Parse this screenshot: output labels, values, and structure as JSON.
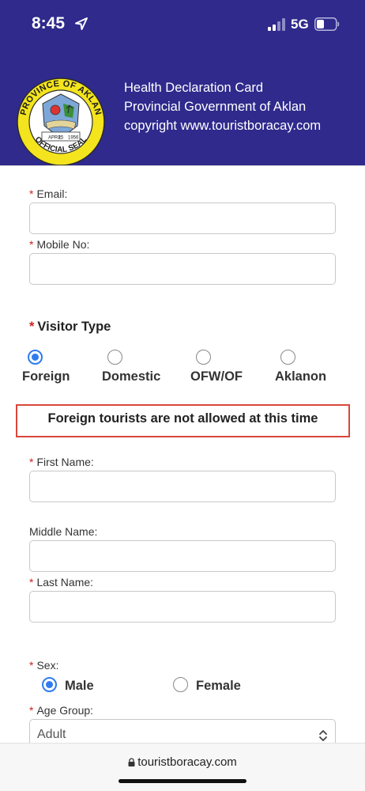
{
  "status_bar": {
    "time": "8:45",
    "network": "5G",
    "icons": [
      "location-arrow-icon",
      "cellular-signal-icon",
      "battery-icon"
    ]
  },
  "header": {
    "line1": "Health Declaration Card",
    "line2": "Provincial Government of Aklan",
    "line3": "copyright www.touristboracay.com",
    "seal": {
      "top_text": "PROVINCE OF AKLAN",
      "bottom_text": "OFFICIAL SEAL",
      "date_left": "APRIL",
      "date_day": "25",
      "date_year": "1956"
    },
    "colors": {
      "background": "#2f2a8c",
      "text": "#ffffff"
    }
  },
  "form": {
    "email": {
      "label": "Email:",
      "required": "*",
      "value": ""
    },
    "mobile": {
      "label": "Mobile No:",
      "required": "*",
      "value": ""
    },
    "visitor_type": {
      "label": "Visitor Type",
      "required": "*",
      "options": [
        "Foreign",
        "Domestic",
        "OFW/OF",
        "Aklanon"
      ],
      "selected": "Foreign"
    },
    "notice": "Foreign tourists are not allowed at this time",
    "first_name": {
      "label": "First Name:",
      "required": "*",
      "value": ""
    },
    "middle_name": {
      "label": "Middle Name:",
      "value": ""
    },
    "last_name": {
      "label": "Last Name:",
      "required": "*",
      "value": ""
    },
    "sex": {
      "label": "Sex:",
      "required": "*",
      "options": [
        "Male",
        "Female"
      ],
      "selected": "Male"
    },
    "age_group": {
      "label": "Age Group:",
      "required": "*",
      "value": "Adult"
    },
    "colors": {
      "required": "#d21f1f",
      "radio_selected": "#2f7bf0",
      "notice_border": "#d9473b"
    }
  },
  "browser": {
    "url": "touristboracay.com",
    "icons": [
      "lock-icon"
    ]
  }
}
